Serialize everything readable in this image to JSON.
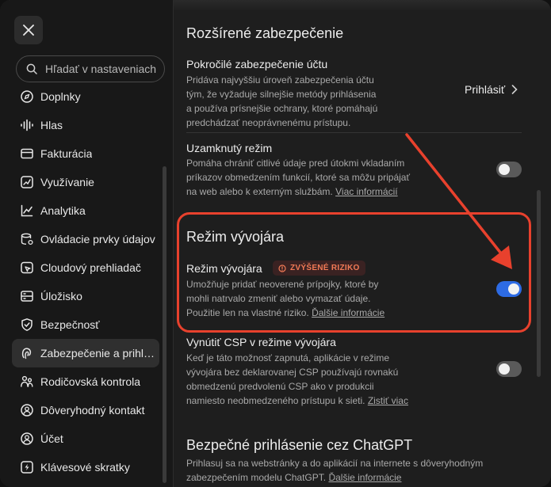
{
  "sidebar": {
    "search_placeholder": "Hľadať v nastaveniach",
    "items": [
      {
        "icon": "globe-icon",
        "label": "Doplnky"
      },
      {
        "icon": "voice-icon",
        "label": "Hlas"
      },
      {
        "icon": "credit-card-icon",
        "label": "Fakturácia"
      },
      {
        "icon": "usage-icon",
        "label": "Využívanie"
      },
      {
        "icon": "analytics-icon",
        "label": "Analytika"
      },
      {
        "icon": "data-controls-icon",
        "label": "Ovládacie prvky údajov"
      },
      {
        "icon": "cloud-browser-icon",
        "label": "Cloudový prehliadač"
      },
      {
        "icon": "storage-icon",
        "label": "Úložisko"
      },
      {
        "icon": "shield-icon",
        "label": "Bezpečnosť"
      },
      {
        "icon": "lock-face-icon",
        "label": "Zabezpečenie a prihlásenie"
      },
      {
        "icon": "family-icon",
        "label": "Rodičovská kontrola"
      },
      {
        "icon": "trusted-contact-icon",
        "label": "Dôveryhodný kontakt"
      },
      {
        "icon": "account-icon",
        "label": "Účet"
      },
      {
        "icon": "keyboard-icon",
        "label": "Klávesové skratky"
      }
    ],
    "active_index": 9
  },
  "main": {
    "section_advanced": {
      "title": "Rozšírené zabezpečenie",
      "advanced_account": {
        "title": "Pokročilé zabezpečenie účtu",
        "lines": [
          "Pridáva najvyššiu úroveň zabezpečenia účtu",
          "tým, že vyžaduje silnejšie metódy prihlásenia",
          "a používa prísnejšie ochrany, ktoré pomáhajú",
          "predchádzať neoprávnenému prístupu."
        ],
        "action_label": "Prihlásiť"
      },
      "locked_mode": {
        "title": "Uzamknutý režim",
        "lines": [
          "Pomáha chrániť citlivé údaje pred útokmi vkladaním",
          "príkazov obmedzením funkcií, ktoré sa môžu pripájať",
          "na web alebo k externým službám."
        ],
        "link": "Viac informácií",
        "enabled": false
      }
    },
    "section_developer": {
      "title": "Režim vývojára",
      "developer_mode": {
        "title": "Režim vývojára",
        "badge": "ZVÝŠENÉ RIZIKO",
        "lines": [
          "Umožňuje pridať neoverené prípojky, ktoré by",
          "mohli natrvalo zmeniť alebo vymazať údaje.",
          "Použitie len na vlastné riziko."
        ],
        "link": "Ďalšie informácie",
        "enabled": true
      },
      "enforce_csp": {
        "title": "Vynútiť CSP v režime vývojára",
        "lines": [
          "Keď je táto možnosť zapnutá, aplikácie v režime",
          "vývojára bez deklarovanej CSP používajú rovnakú",
          "obmedzenú predvolenú CSP ako v produkcii",
          "namiesto neobmedzeného prístupu k sieti."
        ],
        "link": "Zistiť viac",
        "enabled": false
      }
    },
    "section_secure_login": {
      "title": "Bezpečné prihlásenie cez ChatGPT",
      "lines": [
        "Prihlasuj sa na webstránky a do aplikácií na internete s dôveryhodným",
        "zabezpečením modelu ChatGPT."
      ],
      "link": "Ďalšie informácie"
    }
  },
  "colors": {
    "accent": "#2d6be4",
    "annotation": "#e8412d",
    "badge_text": "#f27a56"
  }
}
